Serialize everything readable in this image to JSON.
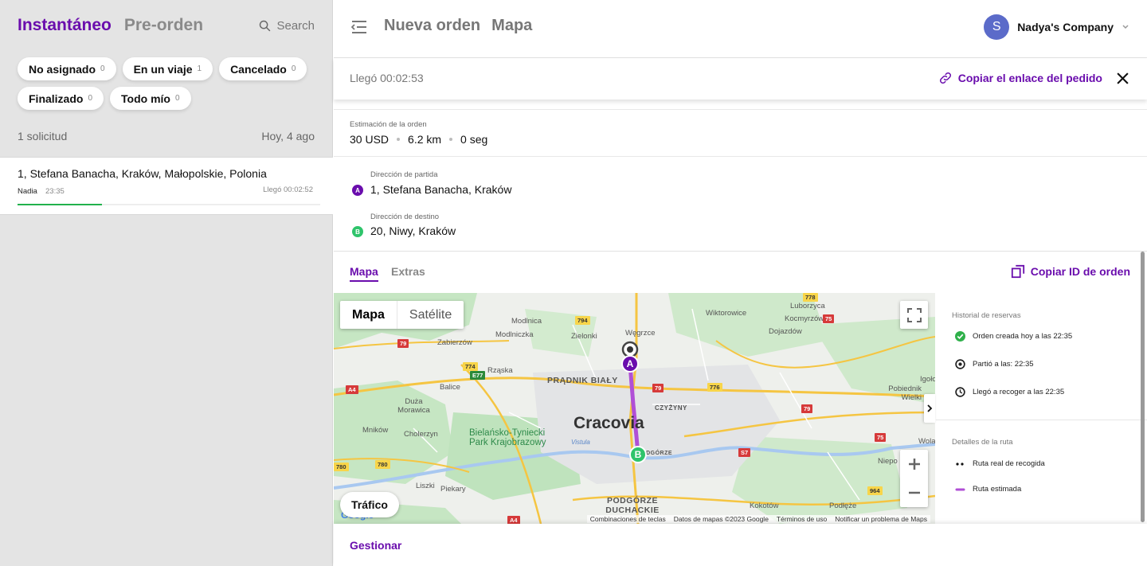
{
  "left": {
    "tabs": [
      {
        "label": "Instantáneo"
      },
      {
        "label": "Pre-orden"
      }
    ],
    "search_label": "Search",
    "chips": [
      {
        "label": "No asignado",
        "count": "0"
      },
      {
        "label": "En un viaje",
        "count": "1"
      },
      {
        "label": "Cancelado",
        "count": "0"
      },
      {
        "label": "Finalizado",
        "count": "0"
      },
      {
        "label": "Todo mío",
        "count": "0"
      }
    ],
    "requests_count": "1 solicitud",
    "date": "Hoy, 4 ago",
    "orders": [
      {
        "address": "1, Stefana Banacha, Kraków, Małopolskie, Polonia",
        "driver": "Nadia",
        "time": "23:35",
        "status": "Llegó 00:02:52",
        "progress": 0.28
      }
    ]
  },
  "header": {
    "tabs": [
      {
        "label": "Nueva orden"
      },
      {
        "label": "Mapa"
      }
    ],
    "company": {
      "initial": "S",
      "name": "Nadya's Company"
    }
  },
  "status": {
    "arrived": "Llegó 00:02:53",
    "copy_link": "Copiar el enlace del pedido"
  },
  "estimate": {
    "label": "Estimación de la orden",
    "price": "30 USD",
    "distance": "6.2 km",
    "duration": "0 seg"
  },
  "addresses": {
    "pickup_label": "Dirección de partida",
    "pickup": "1, Stefana Banacha, Kraków",
    "pickup_pin": "A",
    "dest_label": "Dirección de destino",
    "dest": "20, Niwy, Kraków",
    "dest_pin": "B"
  },
  "content_tabs": {
    "tabs": [
      {
        "label": "Mapa"
      },
      {
        "label": "Extras"
      }
    ],
    "copy_id": "Copiar ID de orden"
  },
  "map": {
    "type_buttons": [
      "Mapa",
      "Satélite"
    ],
    "traffic": "Tráfico",
    "marker_a": "A",
    "marker_b": "B",
    "city_label": "Cracovia",
    "labels": {
      "modlnica": "Modlnica",
      "wiktorowice": "Wiktorowice",
      "luborzyca": "Luborzyca",
      "kocmyrzow": "Kocmyrzów",
      "zielonki": "Zielonki",
      "wegrzce": "Węgrzce",
      "dojazdow": "Dojazdów",
      "zabierzow": "Zabierzów",
      "modlniczka": "Modlniczka",
      "rzaska": "Rząska",
      "balice": "Balice",
      "pradnik": "PRĄDNIK BIAŁY",
      "czyzyny": "CZYŻYNY",
      "igolomia": "Igołom",
      "pobiednik": "Pobiednik Wielki",
      "duza": "Duża Morawica",
      "mnikow": "Mników",
      "cholerzyn": "Cholerzyn",
      "park": "Bielańsko-Tyniecki Park Krajobrazowy",
      "liszki": "Liszki",
      "piekary": "Piekary",
      "podgorze": "PODGÓRZE DUCHACKIE",
      "podgorze_small": "PODGÓRZE",
      "kokotow": "Kokotów",
      "podleze": "Podłęże",
      "niepo": "Niepo",
      "wola": "Wola",
      "wisla": "Vistula",
      "google": "Google"
    },
    "roads": [
      "79",
      "794",
      "774",
      "E77",
      "A4",
      "776",
      "79",
      "79",
      "780",
      "780",
      "S7",
      "75",
      "964",
      "A4",
      "778",
      "75"
    ],
    "attribution": [
      "Combinaciones de teclas",
      "Datos de mapas ©2023 Google",
      "Términos de uso",
      "Notificar un problema de Maps"
    ]
  },
  "history": {
    "title": "Historial de reservas",
    "items": [
      {
        "text": "Orden creada hoy a las 22:35"
      },
      {
        "text": "Partió a las: 22:35"
      },
      {
        "text": "Llegó a recoger a las 22:35"
      }
    ],
    "route_title": "Detalles de la ruta",
    "route_items": [
      {
        "text": "Ruta real de recogida"
      },
      {
        "text": "Ruta estimada"
      }
    ]
  },
  "footer": {
    "manage": "Gestionar"
  },
  "colors": {
    "accent": "#6a0dad",
    "green": "#2fc46b",
    "route": "#b04fd6"
  }
}
